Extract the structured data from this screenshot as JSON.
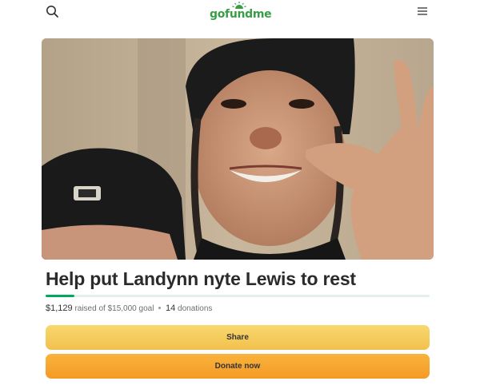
{
  "header": {
    "logo_text": "gofundme",
    "search_icon": "search-icon",
    "menu_icon": "hamburger-menu-icon"
  },
  "campaign": {
    "title": "Help put Landynn nyte Lewis to rest",
    "raised_amount": "$1,129",
    "raised_label": "raised of",
    "goal_amount": "$15,000",
    "goal_label": "goal",
    "donation_count": "14",
    "donations_label": "donations",
    "progress_fraction": 0.0753
  },
  "actions": {
    "share_label": "Share",
    "donate_label": "Donate now"
  },
  "colors": {
    "brand_green": "#02a95c",
    "share_button": "#f5c95a",
    "donate_button": "#f6a52f"
  }
}
